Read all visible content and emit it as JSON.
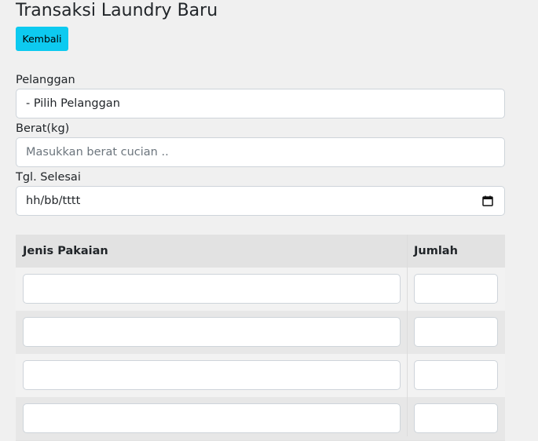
{
  "page": {
    "title": "Transaksi Laundry Baru",
    "back_label": "Kembali"
  },
  "form": {
    "customer": {
      "label": "Pelanggan",
      "selected": "- Pilih Pelanggan"
    },
    "weight": {
      "label": "Berat(kg)",
      "placeholder": "Masukkan berat cucian .."
    },
    "finish_date": {
      "label": "Tgl. Selesai",
      "value": "hh/bb/tttt",
      "icon": "calendar-icon"
    }
  },
  "table": {
    "headers": [
      "Jenis Pakaian",
      "Jumlah"
    ],
    "rows": [
      {
        "jenis": "",
        "jumlah": ""
      },
      {
        "jenis": "",
        "jumlah": ""
      },
      {
        "jenis": "",
        "jumlah": ""
      },
      {
        "jenis": "",
        "jumlah": ""
      }
    ]
  },
  "colors": {
    "accent": "#0dcaf0",
    "background": "#f0f0f0"
  }
}
